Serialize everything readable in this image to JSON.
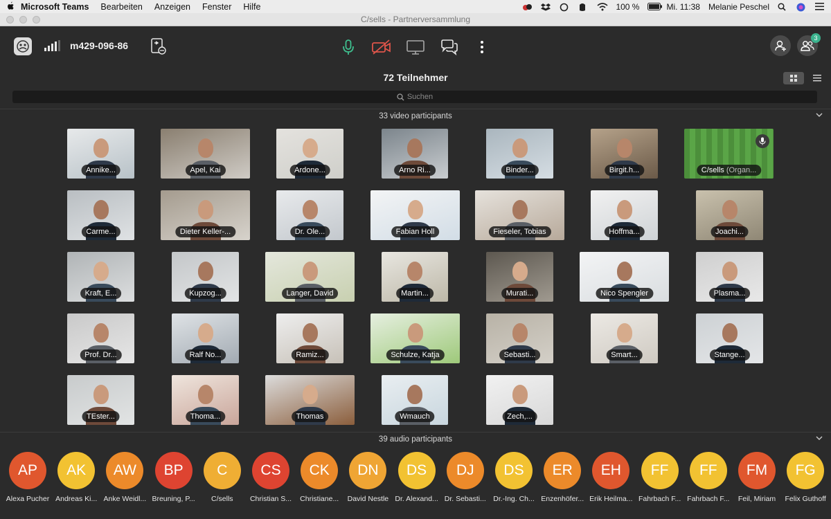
{
  "menubar": {
    "apple": "",
    "items": [
      "Microsoft Teams",
      "Bearbeiten",
      "Anzeigen",
      "Fenster",
      "Hilfe"
    ],
    "battery": "100 %",
    "clock": "Mi. 11:38",
    "user": "Melanie Peschel"
  },
  "window": {
    "title": "C/sells - Partnerversammlung"
  },
  "topbar": {
    "meeting_id": "m429-096-86",
    "people_badge": "3"
  },
  "participants": {
    "title": "72 Teilnehmer",
    "search_placeholder": "Suchen",
    "video_section": "33 video participants",
    "audio_section": "39 audio participants"
  },
  "video_tiles": [
    {
      "label": "Annike..."
    },
    {
      "label": "Apel, Kai"
    },
    {
      "label": "Ardone..."
    },
    {
      "label": "Arno Ri..."
    },
    {
      "label": "Binder..."
    },
    {
      "label": "Birgit.h..."
    },
    {
      "label": "C/sells",
      "suffix": "(Organ..."
    },
    {
      "label": "Carme..."
    },
    {
      "label": "Dieter Keller-..."
    },
    {
      "label": "Dr. Ole..."
    },
    {
      "label": "Fabian Holl"
    },
    {
      "label": "Fieseler, Tobias"
    },
    {
      "label": "Hoffma..."
    },
    {
      "label": "Joachi..."
    },
    {
      "label": "Kraft, E..."
    },
    {
      "label": "Kupzog..."
    },
    {
      "label": "Langer, David"
    },
    {
      "label": "Martin..."
    },
    {
      "label": "Murati..."
    },
    {
      "label": "Nico Spengler"
    },
    {
      "label": "Plasma..."
    },
    {
      "label": "Prof. Dr..."
    },
    {
      "label": "Ralf No..."
    },
    {
      "label": "Ramiz..."
    },
    {
      "label": "Schulze, Katja"
    },
    {
      "label": "Sebasti..."
    },
    {
      "label": "Smart..."
    },
    {
      "label": "Stange..."
    },
    {
      "label": "TEster..."
    },
    {
      "label": "Thoma..."
    },
    {
      "label": "Thomas"
    },
    {
      "label": "Wmauch"
    },
    {
      "label": "Zech,..."
    }
  ],
  "audio_participants": [
    {
      "initials": "AP",
      "name": "Alexa Pucher",
      "color": "#e0572e"
    },
    {
      "initials": "AK",
      "name": "Andreas Ki...",
      "color": "#f2c232"
    },
    {
      "initials": "AW",
      "name": "Anke Weidl...",
      "color": "#ec8a2a"
    },
    {
      "initials": "BP",
      "name": "Breuning, P...",
      "color": "#de4431"
    },
    {
      "initials": "C",
      "name": "C/sells",
      "color": "#efae34"
    },
    {
      "initials": "CS",
      "name": "Christian S...",
      "color": "#de4431"
    },
    {
      "initials": "CK",
      "name": "Christiane...",
      "color": "#ec8a2a"
    },
    {
      "initials": "DN",
      "name": "David Nestle",
      "color": "#efa534"
    },
    {
      "initials": "DS",
      "name": "Dr. Alexand...",
      "color": "#f2c232"
    },
    {
      "initials": "DJ",
      "name": "Dr. Sebasti...",
      "color": "#ec8a2a"
    },
    {
      "initials": "DS",
      "name": "Dr.-Ing. Ch...",
      "color": "#f2c232"
    },
    {
      "initials": "ER",
      "name": "Enzenhöfer...",
      "color": "#ec8a2a"
    },
    {
      "initials": "EH",
      "name": "Erik Heilma...",
      "color": "#e0572e"
    },
    {
      "initials": "FF",
      "name": "Fahrbach F...",
      "color": "#f2c232"
    },
    {
      "initials": "FF",
      "name": "Fahrbach F...",
      "color": "#f2c232"
    },
    {
      "initials": "FM",
      "name": "Feil, Miriam",
      "color": "#e0572e"
    },
    {
      "initials": "FG",
      "name": "Felix Guthoff",
      "color": "#f2c232"
    }
  ]
}
